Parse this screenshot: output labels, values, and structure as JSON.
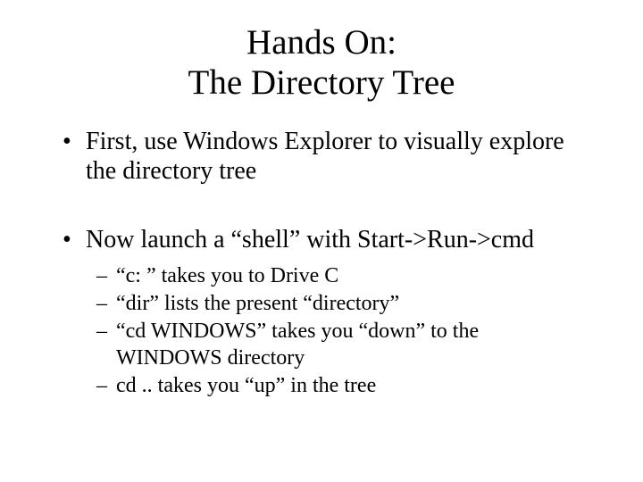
{
  "title_line1": "Hands On:",
  "title_line2": "The Directory Tree",
  "bullets": [
    {
      "text": "First, use Windows Explorer to visually explore the directory tree",
      "sub": []
    },
    {
      "text": "Now launch a “shell” with Start->Run->cmd",
      "sub": [
        "“c: ” takes you to Drive C",
        "“dir” lists the present “directory”",
        "“cd WINDOWS” takes you “down” to the WINDOWS directory",
        "cd .. takes you “up” in the tree"
      ]
    }
  ]
}
